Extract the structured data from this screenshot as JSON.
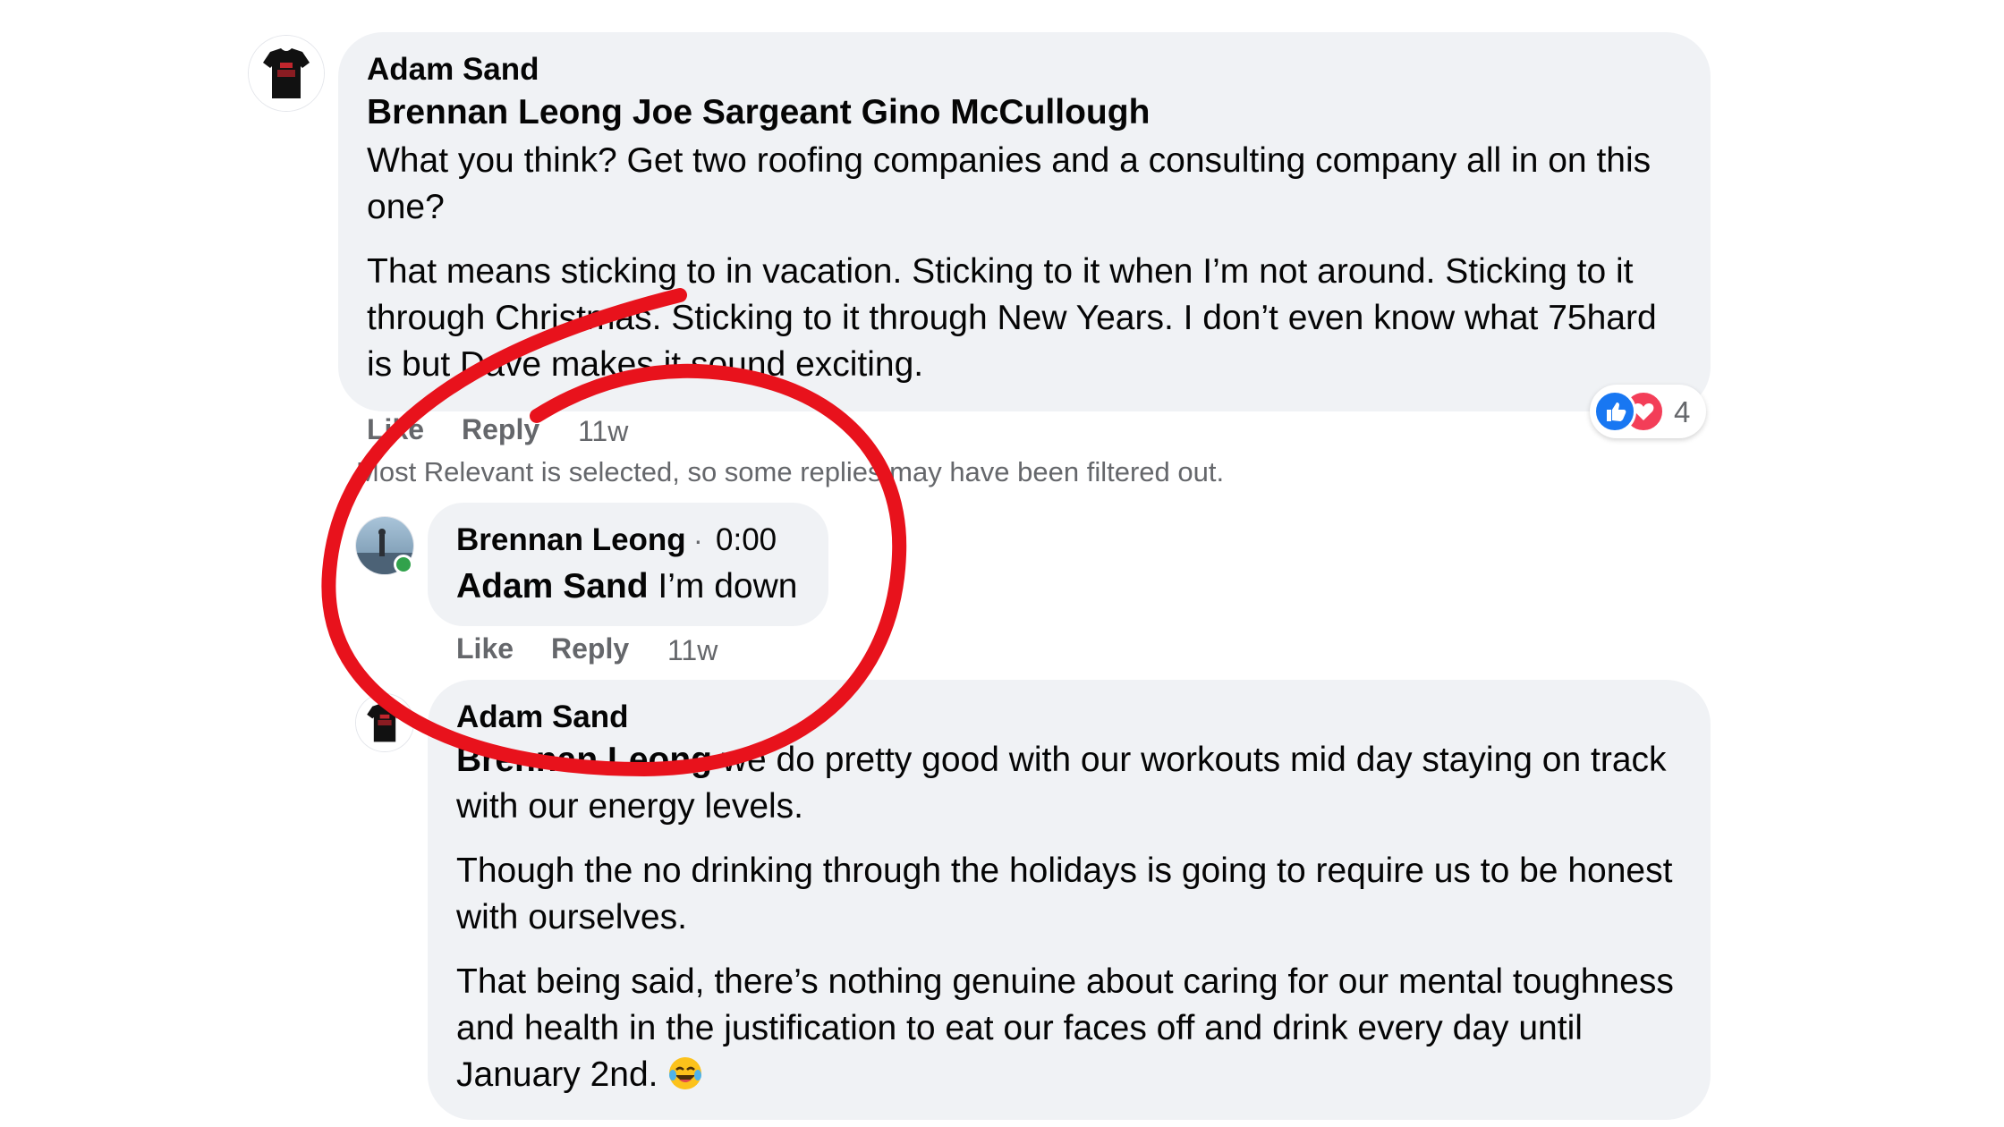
{
  "comments": [
    {
      "author": "Adam Sand",
      "avatar_icon": "tshirt-avatar-icon",
      "mentions": "Brennan Leong Joe Sargeant Gino McCullough",
      "paragraphs": [
        "What you think? Get two roofing companies and a consulting company all in on this one?",
        "That means sticking to in vacation. Sticking to it when I’m not around. Sticking to it through Christmas. Sticking to it through New Years. I don’t even know what 75hard is but Dave makes it sound exciting."
      ],
      "like_label": "Like",
      "reply_label": "Reply",
      "time": "11w",
      "reactions": {
        "icons": [
          "like-reaction-icon",
          "love-reaction-icon"
        ],
        "count": "4"
      }
    }
  ],
  "filter_notice": "Most Relevant is selected, so some replies may have been filtered out.",
  "replies": [
    {
      "author": "Brennan Leong",
      "separator": "·",
      "video_time": "0:00",
      "mention": "Adam Sand",
      "text": " I’m down",
      "like_label": "Like",
      "reply_label": "Reply",
      "time": "11w",
      "online": true
    },
    {
      "author": "Adam Sand",
      "mention": "Brennan Leong",
      "first_text": " we do pretty good with our workouts mid day staying on track with our energy levels.",
      "paragraphs": [
        "Though the no drinking through the holidays is going to require us to be honest with ourselves.",
        "That being said, there’s nothing genuine about caring for our mental toughness and health in the justification to eat our faces off and drink every day until January 2nd."
      ],
      "emoji": "laughing-tears-emoji-icon"
    }
  ],
  "colors": {
    "bubble": "#f0f2f5",
    "secondary_text": "#65676b",
    "like_blue": "#1877f2",
    "love_red": "#f33e58",
    "annotation_red": "#e8121c",
    "online_green": "#31a24c"
  }
}
